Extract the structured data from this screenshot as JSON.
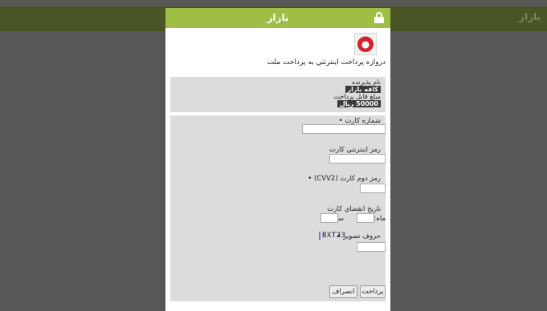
{
  "app": {
    "brand": "بازار"
  },
  "header": {
    "brand": "بازار",
    "lock_icon": "lock-icon",
    "accent_color": "#a0bd45"
  },
  "gateway": {
    "title": "دروازه پرداخت اینترنتي به پرداخت ملت",
    "bank_logo": "bank-mellat-logo"
  },
  "info": {
    "merchant_label": "نام پذيرنده",
    "merchant_value": "كافه بازار",
    "amount_label": "مبلغ قابل پرداخت",
    "amount_value": "50000 ريال"
  },
  "form": {
    "card_number_label": "شماره کارت •",
    "card_number_value": "",
    "pin_label": "رمز اینترنتي كارت",
    "pin_value": "",
    "cvv2_label": "رمز دوم کارت (CVV2) •",
    "cvv2_value": "",
    "expiry_label": "تاريخ انقضاي كارت",
    "month_label": "ماه:",
    "month_value": "",
    "year_label": "سال:",
    "year_value": "",
    "captcha_label": "حروف تصوير •",
    "captcha_text": "BXT23",
    "captcha_value": ""
  },
  "buttons": {
    "pay": "پرداخت",
    "cancel": "انصراف"
  }
}
